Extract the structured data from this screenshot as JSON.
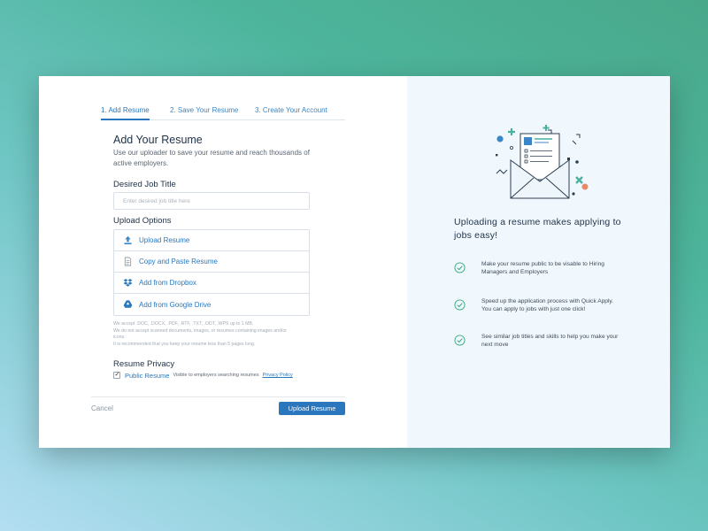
{
  "tabs": [
    "1. Add Resume",
    "2. Save Your Resume",
    "3. Create Your Account"
  ],
  "form": {
    "title": "Add Your Resume",
    "description": "Use our uploader to save your resume and reach thousands of active employers.",
    "job_title_label": "Desired Job Title",
    "job_title_placeholder": "Enter desired job title here",
    "upload_options_label": "Upload Options",
    "options": [
      {
        "label": "Upload Resume",
        "icon": "upload-icon"
      },
      {
        "label": "Copy and Paste Resume",
        "icon": "document-icon"
      },
      {
        "label": "Add from Dropbox",
        "icon": "dropbox-icon"
      },
      {
        "label": "Add from Google Drive",
        "icon": "google-drive-icon"
      }
    ],
    "file_notes": [
      "We accept .DOC, .DOCX, .PDF, .RTF, .TXT, .ODT, .WPS up to 1 MB.",
      "We do not accept scanned documents, images, or resumes containing images and/or icons.",
      "It is recommended that you keep your resume less than 5 pages long."
    ],
    "privacy_title": "Resume Privacy",
    "privacy_option": "Public Resume",
    "privacy_desc": "Visible to employers searching resumes",
    "privacy_link": "Privacy Policy",
    "privacy_checked": true
  },
  "footer": {
    "cancel_label": "Cancel",
    "upload_label": "Upload Resume"
  },
  "side": {
    "headline": "Uploading a resume makes applying to jobs easy!",
    "benefits": [
      "Make your resume public to be visable to Hiring Managers and Employers",
      "Speed up the application process with Quick Apply. You can apply to jobs with just one click!",
      "See similar job titles and skills to help you make your next move"
    ]
  },
  "colors": {
    "accent": "#2a77bd",
    "check_green": "#3aaa7f",
    "panel_bg": "#f1f8fd"
  }
}
